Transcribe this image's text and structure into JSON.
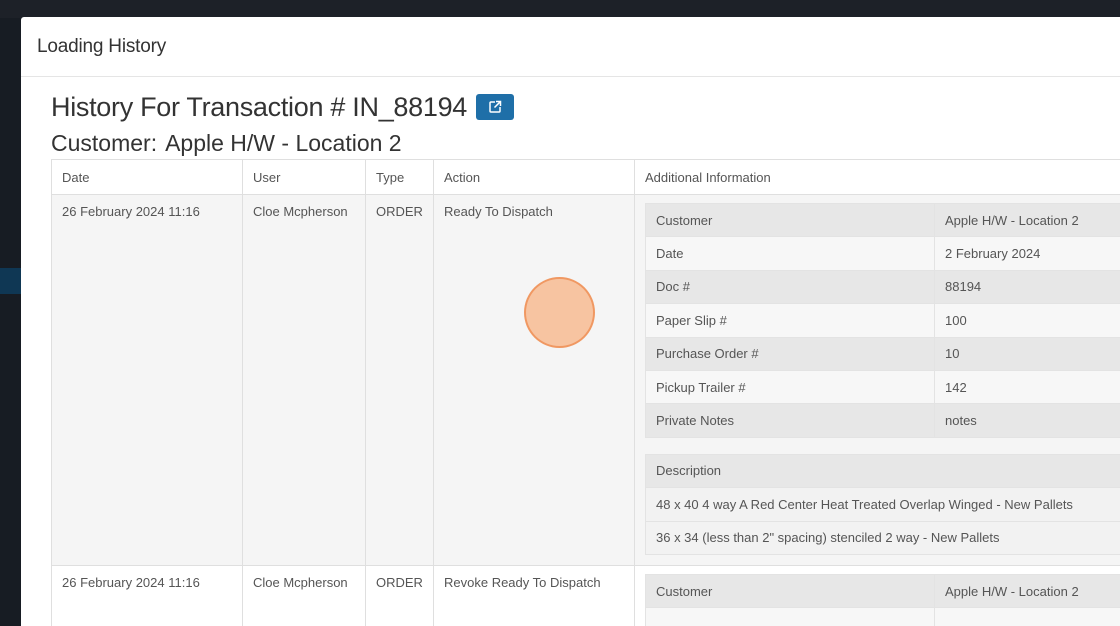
{
  "modal": {
    "title": "Loading History"
  },
  "history": {
    "title": "History For Transaction # IN_88194",
    "customer_label": "Customer:",
    "customer_value": "Apple H/W - Location 2",
    "link_icon": "external-link-icon"
  },
  "table": {
    "headers": {
      "date": "Date",
      "user": "User",
      "type": "Type",
      "action": "Action",
      "info": "Additional Information"
    },
    "rows": [
      {
        "date": "26 February 2024 11:16",
        "user": "Cloe Mcpherson",
        "type": "ORDER",
        "action": "Ready To Dispatch",
        "details": [
          {
            "label": "Customer",
            "value": "Apple H/W - Location 2"
          },
          {
            "label": "Date",
            "value": "2 February 2024"
          },
          {
            "label": "Doc #",
            "value": "88194"
          },
          {
            "label": "Paper Slip #",
            "value": "100"
          },
          {
            "label": "Purchase Order #",
            "value": "10"
          },
          {
            "label": "Pickup Trailer #",
            "value": "142"
          },
          {
            "label": "Private Notes",
            "value": "notes"
          }
        ],
        "description_header": "Description",
        "descriptions": [
          "48 x 40 4 way A Red Center Heat Treated Overlap Winged - New Pallets",
          "36 x 34 (less than 2\" spacing) stenciled 2 way - New Pallets"
        ]
      },
      {
        "date": "26 February 2024 11:16",
        "user": "Cloe Mcpherson",
        "type": "ORDER",
        "action": "Revoke Ready To Dispatch",
        "details": [
          {
            "label": "Customer",
            "value": "Apple H/W - Location 2"
          },
          {
            "label": "",
            "value": ""
          }
        ]
      }
    ]
  },
  "colors": {
    "primary": "#1f6fa8",
    "cursor": "#f8b88c"
  }
}
